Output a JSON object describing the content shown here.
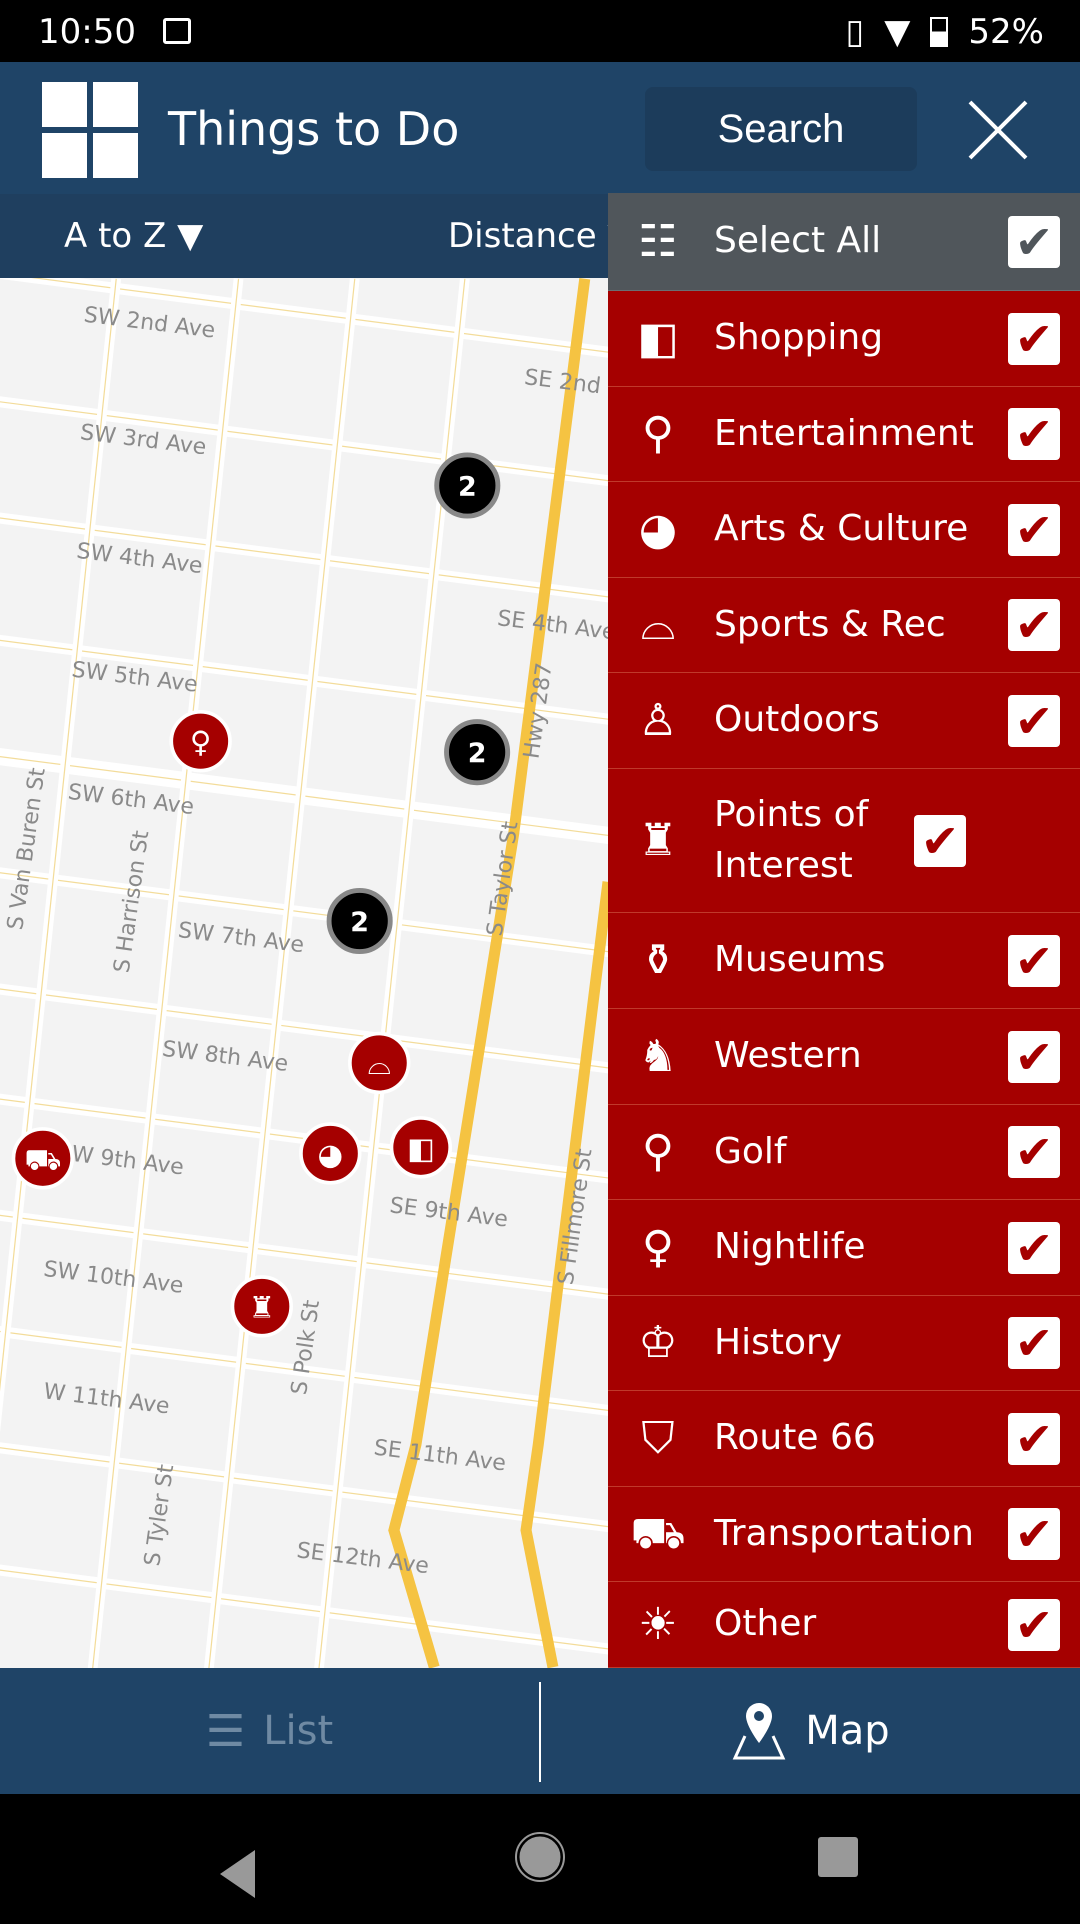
{
  "status_bar": {
    "time": "10:50",
    "battery": "52%"
  },
  "header": {
    "title": "Things to Do",
    "search_label": "Search"
  },
  "sort_bar": {
    "az_label": "A to Z ▼",
    "distance_label": "Distance ▼"
  },
  "filter_panel": {
    "select_all": {
      "label": "Select All",
      "checked": true,
      "icon": "list-edit-icon"
    },
    "categories": [
      {
        "label": "Shopping",
        "checked": true,
        "icon": "shopping-bag-icon"
      },
      {
        "label": "Entertainment",
        "checked": true,
        "icon": "stage-icon"
      },
      {
        "label": "Arts & Culture",
        "checked": true,
        "icon": "palette-icon"
      },
      {
        "label": "Sports & Rec",
        "checked": true,
        "icon": "sneaker-icon"
      },
      {
        "label": "Outdoors",
        "checked": true,
        "icon": "hiker-icon"
      },
      {
        "label": "Points of Interest",
        "checked": true,
        "icon": "landmark-icon"
      },
      {
        "label": "Museums",
        "checked": true,
        "icon": "urn-icon"
      },
      {
        "label": "Western",
        "checked": true,
        "icon": "bronco-icon"
      },
      {
        "label": "Golf",
        "checked": true,
        "icon": "golf-icon"
      },
      {
        "label": "Nightlife",
        "checked": true,
        "icon": "dancer-icon"
      },
      {
        "label": "History",
        "checked": true,
        "icon": "top-hat-icon"
      },
      {
        "label": "Route 66",
        "checked": true,
        "icon": "route66-icon"
      },
      {
        "label": "Transportation",
        "checked": true,
        "icon": "car-icon"
      },
      {
        "label": "Other",
        "checked": true,
        "icon": "lightbulb-icon"
      }
    ]
  },
  "map": {
    "street_labels": [
      "SW 2nd Ave",
      "SE 2nd",
      "SW 3rd Ave",
      "SW 4th Ave",
      "SE 4th Ave",
      "SW 5th Ave",
      "SW 6th Ave",
      "SW 7th Ave",
      "SW 8th Ave",
      "W 9th Ave",
      "SE 9th Ave",
      "SW 10th Ave",
      "W 11th Ave",
      "SE 11th Ave",
      "SE 12th Ave",
      "S Van Buren St",
      "S Harrison St",
      "S Taylor St",
      "Hwy 287",
      "S Fillmore St",
      "S Polk St",
      "S Tyler St"
    ],
    "clusters": [
      "2",
      "2",
      "2"
    ],
    "markers": [
      "nightlife",
      "sports",
      "arts",
      "shopping",
      "transportation",
      "points-of-interest"
    ]
  },
  "bottom_tabs": {
    "list_label": "List",
    "map_label": "Map",
    "active": "Map"
  },
  "colors": {
    "header": "#1f4467",
    "panel_red": "#a50000",
    "select_all_gray": "#50565b",
    "road_yellow": "#f5c342"
  }
}
